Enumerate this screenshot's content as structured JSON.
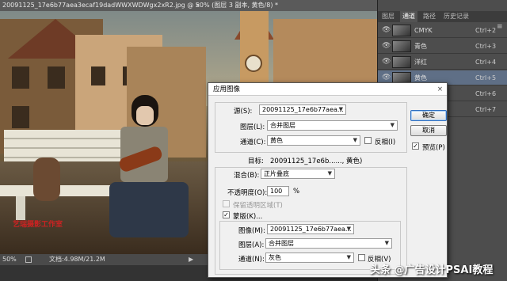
{
  "document": {
    "title": "20091125_17e6b77aea3ecaf19dadWWXWDWgx2xR2.jpg @ 50% (图层 3 副本, 黄色/8) *",
    "close_glyph": "×",
    "status": {
      "zoom": "50%",
      "doc_size": "文档:4.98M/21.2M",
      "arrow": "▶"
    },
    "canvas_logo": "艺瑞摄影工作室"
  },
  "panel": {
    "tabs": [
      "图层",
      "通道",
      "路径",
      "历史记录"
    ],
    "active_tab": "通道",
    "menu_glyph": "≡",
    "channels": [
      {
        "name": "CMYK",
        "shortcut": "Ctrl+2",
        "eye": "👁"
      },
      {
        "name": "青色",
        "shortcut": "Ctrl+3",
        "eye": "👁"
      },
      {
        "name": "洋红",
        "shortcut": "Ctrl+4",
        "eye": "👁"
      },
      {
        "name": "黄色",
        "shortcut": "Ctrl+5",
        "eye": "👁"
      },
      {
        "name": "",
        "shortcut": "Ctrl+6",
        "eye": "👁"
      },
      {
        "name": "",
        "shortcut": "Ctrl+7",
        "eye": ""
      }
    ]
  },
  "dialog": {
    "title": "应用图像",
    "close_glyph": "×",
    "source": {
      "label": "源(S):",
      "value": "20091125_17e6b77aea...",
      "layer_label": "图层(L):",
      "layer_value": "合并图层",
      "channel_label": "通道(C):",
      "channel_value": "黄色",
      "invert_label": "反相(I)",
      "invert_checked": false
    },
    "target": {
      "label": "目标:",
      "value": "20091125_17e6b......, 黄色)"
    },
    "blending": {
      "label": "混合(B):",
      "value": "正片叠底",
      "opacity_label": "不透明度(O):",
      "opacity_value": "100",
      "opacity_unit": "%",
      "preserve_label": "保留透明区域(T)",
      "preserve_checked": false,
      "mask_label": "蒙版(K)...",
      "mask_checked": true
    },
    "mask": {
      "image_label": "图像(M):",
      "image_value": "20091125_17e6b77aea...",
      "layer_label": "图层(A):",
      "layer_value": "合并图层",
      "channel_label": "通道(N):",
      "channel_value": "灰色",
      "invert_label": "反相(V)",
      "invert_checked": false
    },
    "buttons": {
      "ok": "确定",
      "cancel": "取消"
    },
    "preview": {
      "label": "预览(P)",
      "checked": true
    },
    "dropdown_glyph": "▼",
    "check_glyph": "✓"
  },
  "watermark": "头条 @广告设计PSAI教程"
}
